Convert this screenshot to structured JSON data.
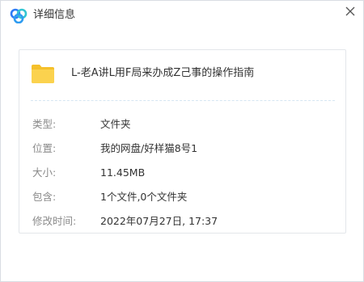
{
  "dialog": {
    "title": "详细信息",
    "close_icon": "close-icon",
    "logo_icon": "baidu-netdisk-logo",
    "accent_colors": {
      "logo_blue": "#2f7cf6",
      "logo_teal": "#32c5d2",
      "folder": "#f5c02b"
    }
  },
  "file": {
    "icon": "folder-icon",
    "name": "L-老A讲L用F局来办成Z己事的操作指南"
  },
  "properties": [
    {
      "label": "类型:",
      "value": "文件夹"
    },
    {
      "label": "位置:",
      "value": "我的网盘/好样猫8号1"
    },
    {
      "label": "大小:",
      "value": "11.45MB"
    },
    {
      "label": "包含:",
      "value": "1个文件,0个文件夹"
    },
    {
      "label": "修改时间:",
      "value": "2022年07月27日, 17:37"
    }
  ]
}
